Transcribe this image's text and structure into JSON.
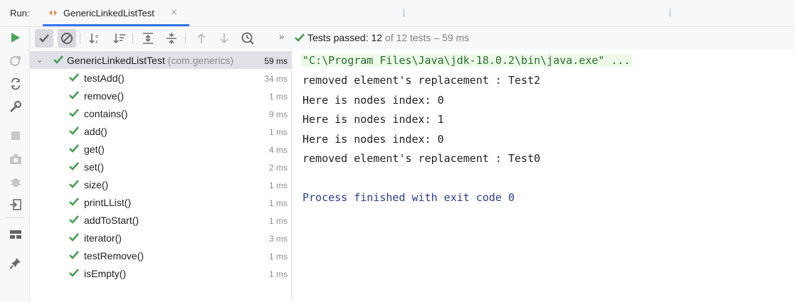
{
  "run_bar": {
    "run_label": "Run:",
    "tab_title": "GenericLinkedListTest",
    "close_glyph": "×"
  },
  "toolbar": {
    "status_prefix": "Tests passed:",
    "passed": "12",
    "status_suffix": "of 12 tests – 59 ms",
    "overflow_glyph": "»"
  },
  "tree": {
    "root": {
      "label": "GenericLinkedListTest",
      "package": "(com.generics)",
      "duration": "59 ms"
    },
    "tests": [
      {
        "label": "testAdd()",
        "duration": "34 ms"
      },
      {
        "label": "remove()",
        "duration": "1 ms"
      },
      {
        "label": "contains()",
        "duration": "9 ms"
      },
      {
        "label": "add()",
        "duration": "1 ms"
      },
      {
        "label": "get()",
        "duration": "4 ms"
      },
      {
        "label": "set()",
        "duration": "2 ms"
      },
      {
        "label": "size()",
        "duration": "1 ms"
      },
      {
        "label": "printLList()",
        "duration": "1 ms"
      },
      {
        "label": "addToStart()",
        "duration": "1 ms"
      },
      {
        "label": "iterator()",
        "duration": "3 ms"
      },
      {
        "label": "testRemove()",
        "duration": "1 ms"
      },
      {
        "label": "isEmpty()",
        "duration": "1 ms"
      }
    ]
  },
  "console": {
    "command": "\"C:\\Program Files\\Java\\jdk-18.0.2\\bin\\java.exe\" ...",
    "lines": [
      "removed element's replacement : Test2",
      "Here is nodes index: 0",
      "Here is nodes index: 1",
      "Here is nodes index: 0",
      "removed element's replacement : Test0"
    ],
    "process_exit": "Process finished with exit code 0"
  },
  "colors": {
    "pass_green": "#499c54",
    "run_green": "#4aa559",
    "accent_blue": "#3574f0"
  }
}
